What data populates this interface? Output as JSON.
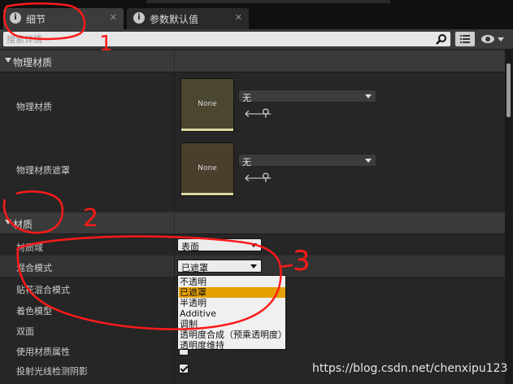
{
  "tabs": [
    {
      "label": "细节",
      "active": true,
      "icon": "info-icon"
    },
    {
      "label": "参数默认值",
      "active": false,
      "icon": "info-icon"
    }
  ],
  "search": {
    "placeholder": "搜索详情",
    "value": ""
  },
  "categories": {
    "physical": "物理材质",
    "material": "材质"
  },
  "physical_rows": [
    {
      "label": "物理材质",
      "thumb_text": "None",
      "value": "无"
    },
    {
      "label": "物理材质遮罩",
      "thumb_text": "None",
      "value": "无"
    }
  ],
  "material_rows": {
    "domain": {
      "label": "材质域",
      "value": "表面"
    },
    "blend_mode": {
      "label": "混合模式",
      "value": "已遮罩"
    },
    "decal_blend_mode": {
      "label": "贴花混合模式"
    },
    "shading_model": {
      "label": "着色模型"
    },
    "two_sided": {
      "label": "双面"
    },
    "use_material_attributes": {
      "label": "使用材质属性"
    },
    "cast_ray_traced_shadows": {
      "label": "投射光线检测阴影",
      "checked": true
    }
  },
  "dropdown_options": [
    {
      "label": "不透明",
      "selected": false
    },
    {
      "label": "已遮罩",
      "selected": true
    },
    {
      "label": "半透明",
      "selected": false
    },
    {
      "label": "Additive",
      "selected": false
    },
    {
      "label": "调制",
      "selected": false
    },
    {
      "label": "透明度合成（预乘透明度）",
      "selected": false
    },
    {
      "label": "透明度维持",
      "selected": false
    }
  ],
  "annotations": [
    "1",
    "2",
    "3"
  ],
  "watermark": "https://blog.csdn.net/chenxipu123",
  "colors": {
    "accent": "#e5a000",
    "annotation": "#ff1a1a"
  }
}
